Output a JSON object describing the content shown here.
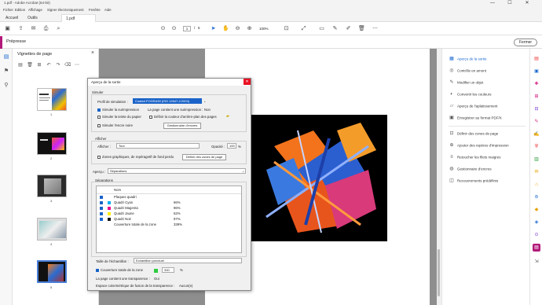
{
  "titlebar": {
    "title": "1.pdf - Adobe Acrobat (64-bit)",
    "minimize": "—",
    "maximize": "☐",
    "close": "✕"
  },
  "menu": [
    "Fichier",
    "Edition",
    "Affichage",
    "Signer électroniquement",
    "Fenêtre",
    "Aide"
  ],
  "tabs": {
    "home": "Accueil",
    "tools": "Outils",
    "file": "1.pdf"
  },
  "toolbar": {
    "page_current": "1",
    "page_sep": "/",
    "page_total": "5",
    "zoom": "100%"
  },
  "prepress": {
    "label": "Prépresse",
    "close_label": "Fermer"
  },
  "thumbs": {
    "title": "Vignettes de page",
    "pages": [
      "1",
      "2",
      "3",
      "4",
      "5"
    ]
  },
  "dialog": {
    "title": "Aperçu de la sortie",
    "simulate_label": "Simuler",
    "profile_label": "Profil de simulation :",
    "profile_value": "Coated FOGRA39 (ISO 12647-2:2004)",
    "simulate_overprint": "Simuler la surimpression",
    "page_overprint_label": "La page contient une surimpression :",
    "page_overprint_value": "Non",
    "simulate_paper": "Simuler la teinte du papier",
    "set_page_bg": "Définir la couleur d'arrière-plan des pages",
    "simulate_black": "Simuler l'encre noire",
    "manage_inks": "Gestionnaire d'encres",
    "show_label": "Afficher",
    "show_field_label": "Afficher :",
    "show_value": "Tout",
    "opacity_label": "Opacité :",
    "opacity_value": "100",
    "percent": "%",
    "warn_label": "Zones graphiques, de repéragetif de fond perdu",
    "define_zones": "Définir des zones de page",
    "preview_label": "Aperçu :",
    "preview_value": "Séparations",
    "separations_label": "Séparations",
    "col_name": "Nom",
    "plates": [
      {
        "name": "Plaques quadri",
        "pct": "",
        "color": ""
      },
      {
        "name": "Quadri Cyan",
        "pct": "66%",
        "color": "#00aeef"
      },
      {
        "name": "Quadri Magenta",
        "pct": "96%",
        "color": "#ec008c"
      },
      {
        "name": "Quadri Jaune",
        "pct": "62%",
        "color": "#ffee00"
      },
      {
        "name": "Quadri Noir",
        "pct": "97%",
        "color": "#111111"
      },
      {
        "name": "Couverture totale de la zone",
        "pct": "339%",
        "color": ""
      }
    ],
    "sample_size_label": "Taille de l'échantillon :",
    "sample_size_value": "Echantillon ponctuel",
    "total_coverage_label": "Couverture totale de la zone",
    "total_coverage_value": "330",
    "page_transparency_label": "La page contient une transparence :",
    "page_transparency_value": "Oui",
    "blending_label": "Espace colorimétrique de fusion de la transparence :",
    "blending_value": "Aucun(e)"
  },
  "right_panel": {
    "items": [
      "Aperçu de la sortie",
      "Contrôle en amont",
      "Modifier un objet",
      "Convertir les couleurs",
      "Aperçu de l'aplatissement",
      "Enregistrer au format PDF/X",
      "Définir des zones de page",
      "Ajouter des repères d'impression",
      "Retoucher les filets maigres",
      "Gestionnaire d'encres",
      "Recouvrements prédéfinis"
    ]
  },
  "colors": {
    "accent": "#b3197a",
    "selected": "#1967d2",
    "close_red": "#e81123"
  }
}
